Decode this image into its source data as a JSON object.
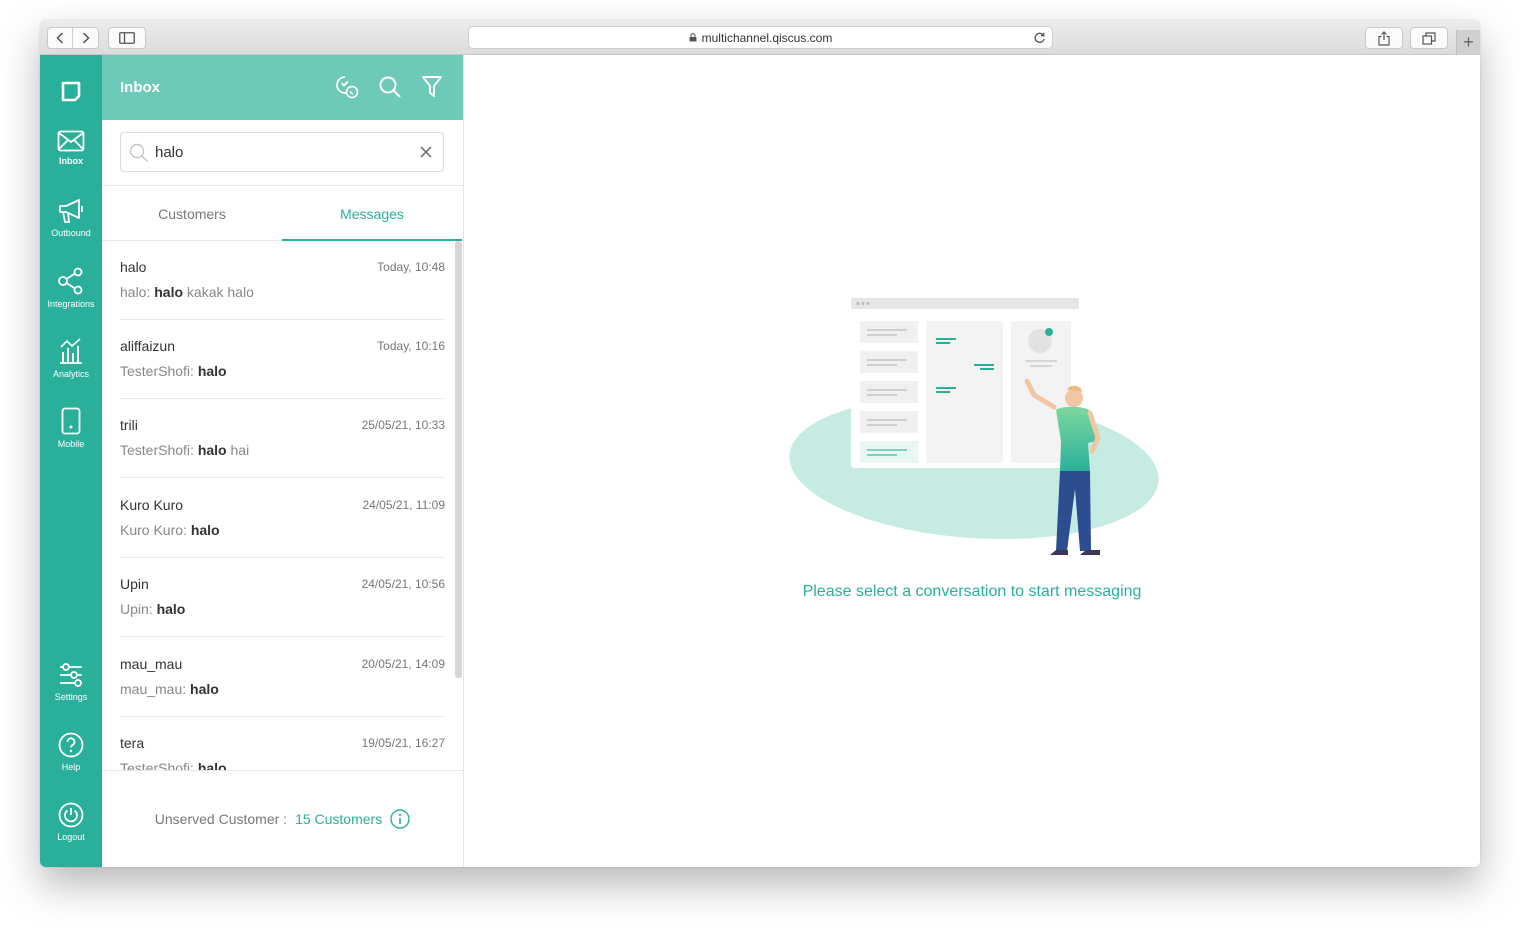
{
  "browser": {
    "url": "multichannel.qiscus.com"
  },
  "rail": {
    "items": [
      {
        "label": "Inbox",
        "active": true
      },
      {
        "label": "Outbound"
      },
      {
        "label": "Integrations"
      },
      {
        "label": "Analytics"
      },
      {
        "label": "Mobile"
      },
      {
        "label": "Settings"
      },
      {
        "label": "Help"
      },
      {
        "label": "Logout"
      }
    ]
  },
  "panel": {
    "title": "Inbox",
    "search": {
      "value": "halo"
    },
    "tabs": [
      {
        "label": "Customers"
      },
      {
        "label": "Messages",
        "active": true
      }
    ],
    "results": [
      {
        "name": "halo",
        "time": "Today, 10:48",
        "sender": "halo",
        "match": "halo",
        "rest": " kakak halo"
      },
      {
        "name": "aliffaizun",
        "time": "Today, 10:16",
        "sender": "TesterShofi",
        "match": "halo",
        "rest": ""
      },
      {
        "name": "trili",
        "time": "25/05/21, 10:33",
        "sender": "TesterShofi",
        "match": "halo",
        "rest": " hai"
      },
      {
        "name": "Kuro Kuro",
        "time": "24/05/21, 11:09",
        "sender": "Kuro Kuro",
        "match": "halo",
        "rest": ""
      },
      {
        "name": "Upin",
        "time": "24/05/21, 10:56",
        "sender": "Upin",
        "match": "halo",
        "rest": ""
      },
      {
        "name": "mau_mau",
        "time": "20/05/21, 14:09",
        "sender": "mau_mau",
        "match": "halo",
        "rest": ""
      },
      {
        "name": "tera",
        "time": "19/05/21, 16:27",
        "sender": "TesterShofi",
        "match": "halo",
        "rest": ""
      }
    ],
    "footer": {
      "label": "Unserved Customer :",
      "value": "15 Customers"
    }
  },
  "main": {
    "empty_message": "Please select a conversation to start messaging"
  },
  "colors": {
    "brand": "#2ab09a",
    "header": "#6dcab8"
  }
}
